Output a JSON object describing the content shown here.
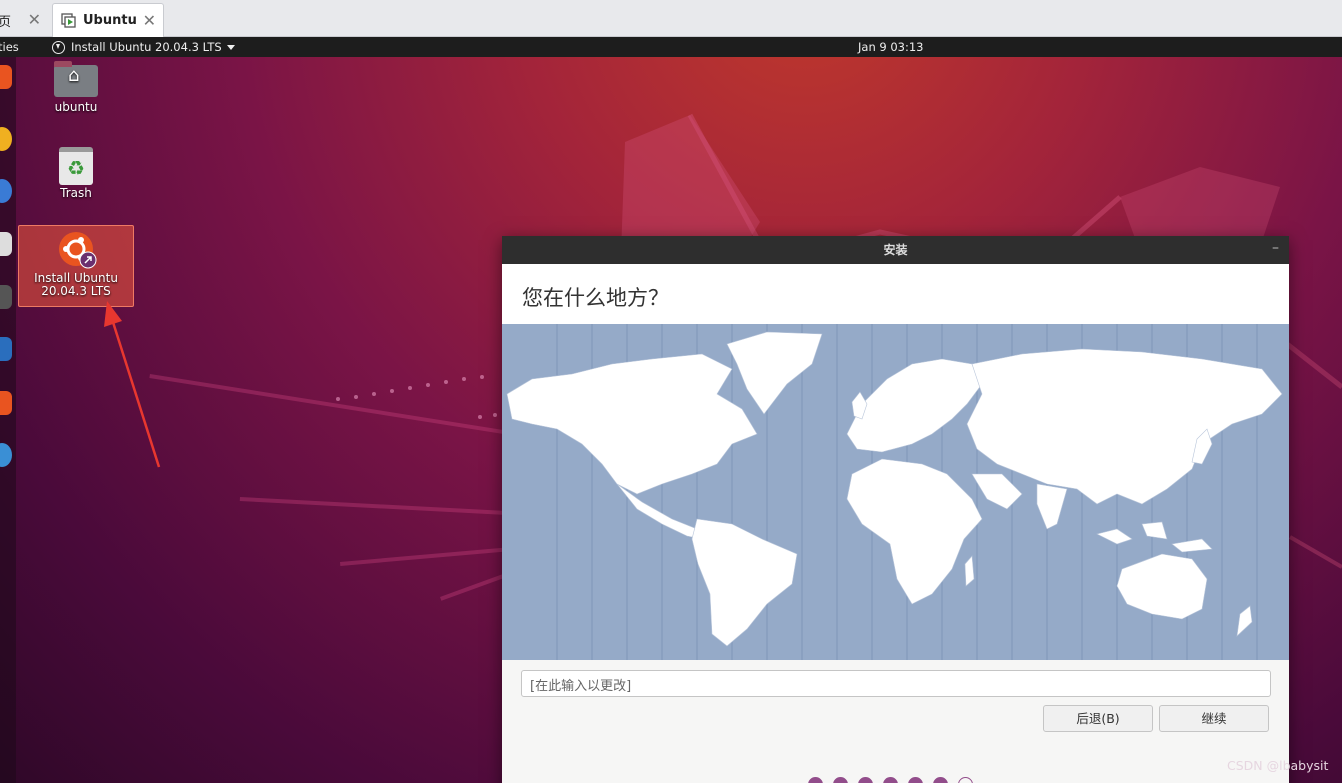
{
  "host_tabs": [
    {
      "label": "页"
    },
    {
      "label": "Ubuntu"
    }
  ],
  "panel": {
    "activities": "ties",
    "app_menu": "Install Ubuntu 20.04.3 LTS",
    "clock": "Jan 9  03:13"
  },
  "desktop_icons": [
    {
      "label": "ubuntu",
      "icon": "home-folder-icon"
    },
    {
      "label": "Trash",
      "icon": "trash-icon"
    },
    {
      "label_line1": "Install Ubuntu",
      "label_line2": "20.04.3 LTS",
      "icon": "ubuntu-installer-icon"
    }
  ],
  "installer": {
    "title": "安装",
    "minimize": "–",
    "heading": "您在什么地方？",
    "timezone_placeholder": "[在此输入以更改]",
    "back_button": "后退(B)",
    "continue_button": "继续",
    "progress": {
      "filled": 6,
      "total": 7
    }
  },
  "watermark": "CSDN @lbabysit",
  "colors": {
    "panel": "#1d1d1d",
    "map_water": "#95aac8",
    "map_land": "#ffffff",
    "progress_dot": "#924d8b",
    "arrow": "#e8372f"
  }
}
